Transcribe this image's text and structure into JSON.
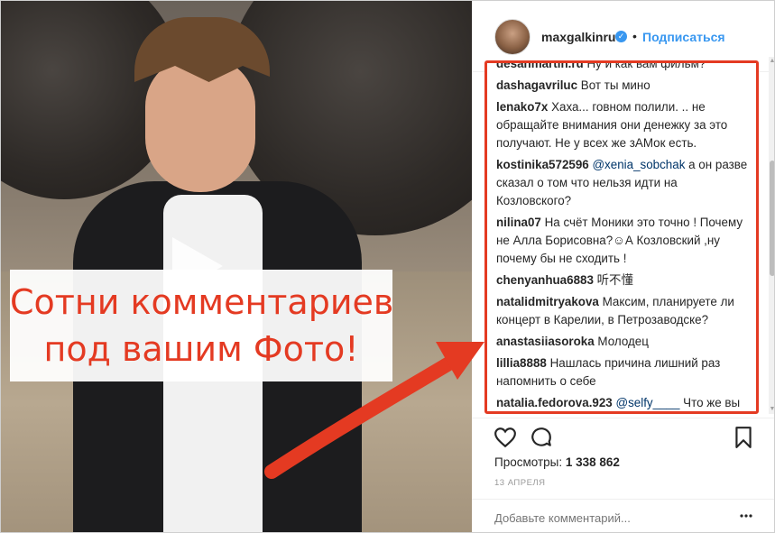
{
  "overlay": {
    "line1": "Сотни комментариев",
    "line2": "под вашим Фото!"
  },
  "header": {
    "username": "maxgalkinru",
    "separator": "•",
    "follow_label": "Подписаться",
    "verified_glyph": "✓"
  },
  "comments": [
    {
      "user": "desanmartin.ru",
      "text": "Ну и как вам фильм?"
    },
    {
      "user": "dashagavriluc",
      "text": "Вот ты мино"
    },
    {
      "user": "lenako7x",
      "text": "Хаха... говном полили. .. не обращайте внимания они денежку за это получают. Не у всех же зАМок есть."
    },
    {
      "user": "kostinika572596",
      "mention": "@xenia_sobchak",
      "text": "а он разве сказал о том что нельзя идти на Козловского?"
    },
    {
      "user": "nilina07",
      "text": "На счёт Моники это точно ! Почему не Алла Борисовна?☺А Козловский ,ну почему бы не сходить !"
    },
    {
      "user": "chenyanhua6883",
      "text": "听不懂"
    },
    {
      "user": "natalidmitryakova",
      "text": "Максим, планируете ли концерт в Карелии, в Петрозаводске?"
    },
    {
      "user": "anastasiiasoroka",
      "text": "Молодец"
    },
    {
      "user": "lillia8888",
      "text": "Нашлась причина лишний раз напомнить о себе"
    },
    {
      "user": "natalia.fedorova.923",
      "mention": "@selfy____",
      "text": "Что же вы всего в Питер без всего?"
    }
  ],
  "actions": {
    "like_icon": "heart-icon",
    "comment_icon": "comment-icon",
    "save_icon": "bookmark-icon"
  },
  "views": {
    "label": "Просмотры:",
    "value": "1 338 862"
  },
  "date": "13 АПРЕЛЯ",
  "add_comment": {
    "placeholder": "Добавьте комментарий..."
  },
  "colors": {
    "accent_red": "#e43a22",
    "link_blue": "#3897f0",
    "mention_blue": "#003569"
  }
}
